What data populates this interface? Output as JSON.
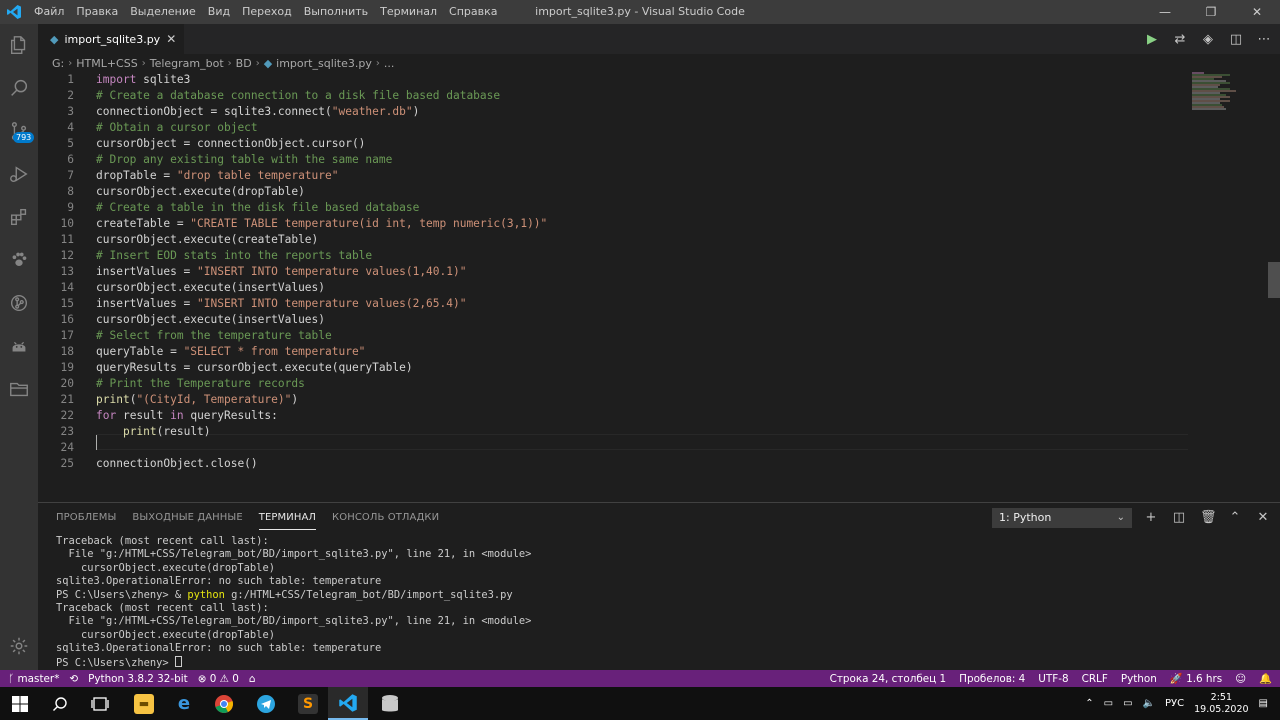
{
  "window": {
    "title": "import_sqlite3.py - Visual Studio Code",
    "menu": [
      "Файл",
      "Правка",
      "Выделение",
      "Вид",
      "Переход",
      "Выполнить",
      "Терминал",
      "Справка"
    ],
    "controls": [
      "—",
      "❐",
      "✕"
    ]
  },
  "activity": {
    "badge": "793"
  },
  "tab": {
    "label": "import_sqlite3.py",
    "close": "✕"
  },
  "breadcrumb": [
    "G:",
    "HTML+CSS",
    "Telegram_bot",
    "BD",
    "import_sqlite3.py",
    "..."
  ],
  "code": {
    "line_numbers": [
      "1",
      "2",
      "3",
      "4",
      "5",
      "6",
      "7",
      "8",
      "9",
      "10",
      "11",
      "12",
      "13",
      "14",
      "15",
      "16",
      "17",
      "18",
      "19",
      "20",
      "21",
      "22",
      "23",
      "24",
      "25"
    ],
    "lines": [
      "import sqlite3",
      "# Create a database connection to a disk file based database",
      "connectionObject = sqlite3.connect(\"weather.db\")",
      "# Obtain a cursor object",
      "cursorObject = connectionObject.cursor()",
      "# Drop any existing table with the same name",
      "dropTable = \"drop table temperature\"",
      "cursorObject.execute(dropTable)",
      "# Create a table in the disk file based database",
      "createTable = \"CREATE TABLE temperature(id int, temp numeric(3,1))\"",
      "cursorObject.execute(createTable)",
      "# Insert EOD stats into the reports table",
      "insertValues = \"INSERT INTO temperature values(1,40.1)\"",
      "cursorObject.execute(insertValues)",
      "insertValues = \"INSERT INTO temperature values(2,65.4)\"",
      "cursorObject.execute(insertValues)",
      "# Select from the temperature table",
      "queryTable = \"SELECT * from temperature\"",
      "queryResults = cursorObject.execute(queryTable)",
      "# Print the Temperature records",
      "print(\"(CityId, Temperature)\")",
      "for result in queryResults:",
      "    print(result)",
      "",
      "connectionObject.close()"
    ]
  },
  "panel": {
    "tabs": [
      "ПРОБЛЕМЫ",
      "ВЫХОДНЫЕ ДАННЫЕ",
      "ТЕРМИНАЛ",
      "КОНСОЛЬ ОТЛАДКИ"
    ],
    "active_tab": "ТЕРМИНАЛ",
    "terminal_select": "1: Python",
    "terminal": {
      "l1": "Traceback (most recent call last):",
      "l2": "  File \"g:/HTML+CSS/Telegram_bot/BD/import_sqlite3.py\", line 21, in <module>",
      "l3": "    cursorObject.execute(dropTable)",
      "l4": "sqlite3.OperationalError: no such table: temperature",
      "l5_prompt": "PS C:\\Users\\zheny> & ",
      "l5_cmd": "python",
      "l5_args": " g:/HTML+CSS/Telegram_bot/BD/import_sqlite3.py",
      "l6": "Traceback (most recent call last):",
      "l7": "  File \"g:/HTML+CSS/Telegram_bot/BD/import_sqlite3.py\", line 21, in <module>",
      "l8": "    cursorObject.execute(dropTable)",
      "l9": "sqlite3.OperationalError: no such table: temperature",
      "l10": "PS C:\\Users\\zheny> "
    }
  },
  "status": {
    "branch": "master*",
    "interpreter": "Python 3.8.2 32-bit",
    "errors": "⊗ 0 ⚠ 0",
    "position": "Строка 24, столбец 1",
    "spaces": "Пробелов: 4",
    "encoding": "UTF-8",
    "eol": "CRLF",
    "language": "Python",
    "time_tracked": "1.6 hrs"
  },
  "taskbar": {
    "lang": "РУС",
    "time": "2:51",
    "date": "19.05.2020"
  },
  "colors": {
    "statusbar": "#68217a",
    "keyword": "#c586c0",
    "string": "#ce9178",
    "comment": "#6a9955"
  }
}
